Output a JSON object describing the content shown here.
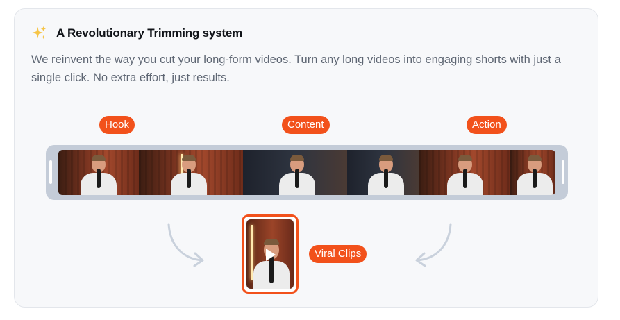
{
  "feature": {
    "icon": "sparkles-icon",
    "title": "A Revolutionary Trimming system",
    "description": "We reinvent the way you cut your long-form videos. Turn any long videos into engaging shorts with just a single click. No extra effort, just results."
  },
  "labels": {
    "hook": "Hook",
    "content": "Content",
    "action": "Action",
    "viral_clips": "Viral Clips"
  },
  "colors": {
    "accent": "#f2511b",
    "track": "#c4ccd8",
    "card_bg": "#f7f8fa",
    "arrow": "#c9d1dc"
  }
}
